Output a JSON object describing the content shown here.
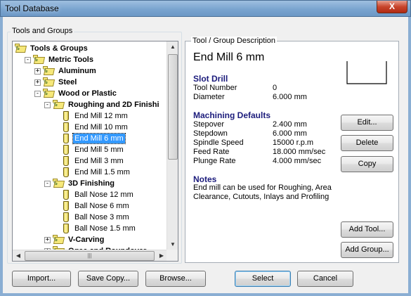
{
  "window": {
    "title": "Tool Database",
    "close_label": "X"
  },
  "left_group": {
    "label": "Tools and Groups"
  },
  "tree": {
    "rows": [
      {
        "label": "Tools & Groups",
        "level": 0,
        "bold": true,
        "kind": "folder",
        "expander": ""
      },
      {
        "label": "Metric Tools",
        "level": 1,
        "bold": true,
        "kind": "folder",
        "expander": "-"
      },
      {
        "label": "Aluminum",
        "level": 2,
        "bold": true,
        "kind": "folder",
        "expander": "+"
      },
      {
        "label": "Steel",
        "level": 2,
        "bold": true,
        "kind": "folder",
        "expander": "+"
      },
      {
        "label": "Wood or Plastic",
        "level": 2,
        "bold": true,
        "kind": "folder",
        "expander": "-"
      },
      {
        "label": "Roughing and 2D Finishi",
        "level": 3,
        "bold": true,
        "kind": "folder",
        "expander": "-"
      },
      {
        "label": "End Mill 12 mm",
        "level": 4,
        "bold": false,
        "kind": "tool",
        "expander": ""
      },
      {
        "label": "End Mill 10 mm",
        "level": 4,
        "bold": false,
        "kind": "tool",
        "expander": ""
      },
      {
        "label": "End Mill 6 mm",
        "level": 4,
        "bold": false,
        "kind": "tool",
        "expander": "",
        "selected": true
      },
      {
        "label": "End Mill 5 mm",
        "level": 4,
        "bold": false,
        "kind": "tool",
        "expander": ""
      },
      {
        "label": "End Mill 3 mm",
        "level": 4,
        "bold": false,
        "kind": "tool",
        "expander": ""
      },
      {
        "label": "End Mill 1.5 mm",
        "level": 4,
        "bold": false,
        "kind": "tool",
        "expander": ""
      },
      {
        "label": "3D Finishing",
        "level": 3,
        "bold": true,
        "kind": "folder",
        "expander": "-"
      },
      {
        "label": "Ball Nose 12 mm",
        "level": 4,
        "bold": false,
        "kind": "tool",
        "expander": ""
      },
      {
        "label": "Ball Nose 6 mm",
        "level": 4,
        "bold": false,
        "kind": "tool",
        "expander": ""
      },
      {
        "label": "Ball Nose 3 mm",
        "level": 4,
        "bold": false,
        "kind": "tool",
        "expander": ""
      },
      {
        "label": "Ball Nose 1.5 mm",
        "level": 4,
        "bold": false,
        "kind": "tool",
        "expander": ""
      },
      {
        "label": "V-Carving",
        "level": 3,
        "bold": true,
        "kind": "folder",
        "expander": "+"
      },
      {
        "label": "Ogee and Roundover",
        "level": 3,
        "bold": true,
        "kind": "folder",
        "expander": "+"
      }
    ]
  },
  "description": {
    "legend": "Tool / Group Description",
    "title": "End Mill 6 mm",
    "type_heading": "Slot Drill",
    "tool_number_label": "Tool Number",
    "tool_number_value": "0",
    "diameter_label": "Diameter",
    "diameter_value": "6.000 mm",
    "machining_heading": "Machining Defaults",
    "stepover_label": "Stepover",
    "stepover_value": "2.400 mm",
    "stepdown_label": "Stepdown",
    "stepdown_value": "6.000 mm",
    "spindle_label": "Spindle Speed",
    "spindle_value": "15000 r.p.m",
    "feed_label": "Feed Rate",
    "feed_value": "18.000 mm/sec",
    "plunge_label": "Plunge Rate",
    "plunge_value": "4.000 mm/sec",
    "notes_heading": "Notes",
    "notes_text": "End mill can be used for Roughing, Area Clearance, Cutouts, Inlays and Profiling"
  },
  "buttons": {
    "edit": "Edit...",
    "delete": "Delete",
    "copy": "Copy",
    "add_tool": "Add Tool...",
    "add_group": "Add Group...",
    "import": "Import...",
    "save_copy": "Save Copy...",
    "browse": "Browse...",
    "select": "Select",
    "cancel": "Cancel"
  }
}
